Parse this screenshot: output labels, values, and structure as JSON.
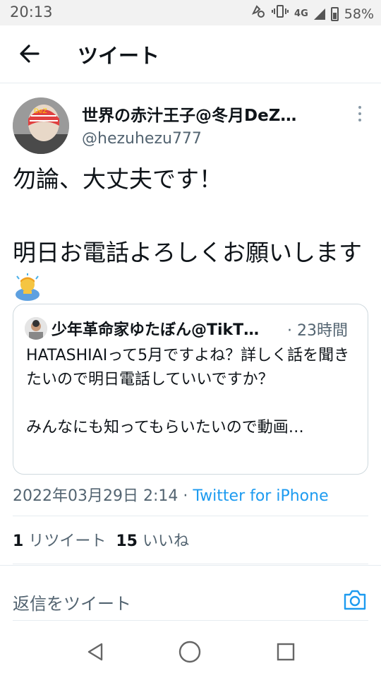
{
  "status_bar": {
    "time": "20:13",
    "network": "4G",
    "battery": "58%"
  },
  "header": {
    "title": "ツイート"
  },
  "tweet": {
    "display_name": "世界の赤汁王子@冬月DeZ…",
    "handle": "@hezuhezu777",
    "text_line1": "勿論、大丈夫です！",
    "text_line2": "明日お電話よろしくお願いします",
    "emoji": "man-bowing",
    "date": "2022年03月29日 2:14",
    "separator": "·",
    "source": "Twitter for iPhone"
  },
  "quoted_tweet": {
    "display_name": "少年革命家ゆたぼん@TikT…",
    "time": "· 23時間",
    "text": "HATASHIAIって5月ですよね？詳しく話を聞きたいので明日電話していいですか？\n\nみんなにも知ってもらいたいので動画…"
  },
  "stats": {
    "retweets_count": "1",
    "retweets_label": "リツイート",
    "likes_count": "15",
    "likes_label": "いいね"
  },
  "reply": {
    "placeholder": "返信をツイート"
  },
  "colors": {
    "accent": "#1d9bf0",
    "secondary_text": "#536471",
    "primary_text": "#0f1419"
  }
}
